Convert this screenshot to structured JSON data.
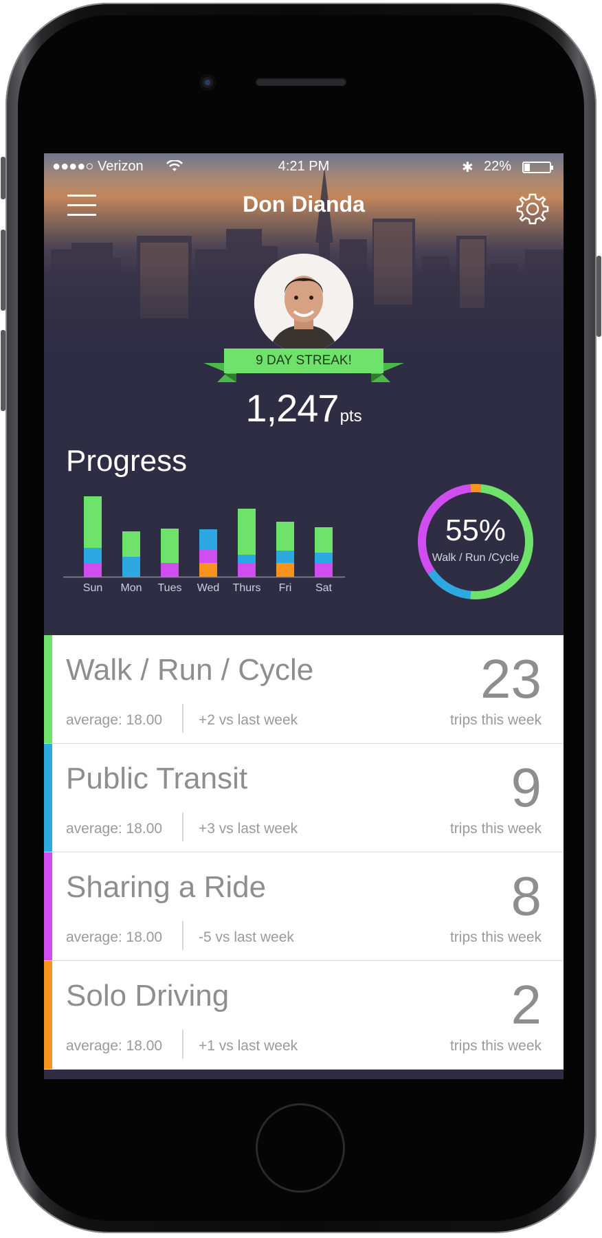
{
  "status_bar": {
    "carrier": "●●●●○ Verizon",
    "time": "4:21 PM",
    "bluetooth": "✱",
    "battery": "22%",
    "battery_level": 0.22
  },
  "header": {
    "user_name": "Don Dianda",
    "menu_icon": "hamburger-menu-icon",
    "settings_icon": "gear-icon",
    "streak_label": "9 DAY STREAK!",
    "points_value": "1,247",
    "points_unit": "pts"
  },
  "progress": {
    "title": "Progress",
    "donut_value": "55%",
    "donut_label": "Walk / Run /Cycle"
  },
  "colors": {
    "walk": "#6ee26a",
    "transit": "#2ea8e0",
    "ride": "#d04ef0",
    "solo": "#f7941d",
    "background": "#2f2d44"
  },
  "chart_data": [
    {
      "type": "bar",
      "stacked": true,
      "categories": [
        "Sun",
        "Mon",
        "Tues",
        "Wed",
        "Thurs",
        "Fri",
        "Sat"
      ],
      "series": [
        {
          "color": "#f7941d",
          "values": [
            0,
            0,
            0,
            20,
            0,
            20,
            0
          ]
        },
        {
          "color": "#d04ef0",
          "values": [
            20,
            0,
            20,
            20,
            20,
            0,
            20
          ]
        },
        {
          "color": "#2ea8e0",
          "values": [
            22,
            29,
            0,
            29,
            12,
            18,
            15
          ]
        },
        {
          "color": "#6ee26a",
          "values": [
            75,
            37,
            50,
            0,
            67,
            42,
            37
          ]
        }
      ],
      "grid": false
    },
    {
      "type": "pie",
      "donut": true,
      "series": [
        {
          "color": "#6ee26a",
          "value": 50
        },
        {
          "color": "#2ea8e0",
          "value": 14
        },
        {
          "color": "#d04ef0",
          "value": 33
        },
        {
          "color": "#f7941d",
          "value": 3
        }
      ]
    }
  ],
  "list": [
    {
      "title": "Walk / Run / Cycle",
      "average": "average: 18.00",
      "delta": "+2 vs last week",
      "count": "23",
      "count_label": "trips this week",
      "color": "#6ee26a"
    },
    {
      "title": "Public Transit",
      "average": "average: 18.00",
      "delta": "+3 vs last week",
      "count": "9",
      "count_label": "trips this week",
      "color": "#2ea8e0"
    },
    {
      "title": "Sharing a Ride",
      "average": "average: 18.00",
      "delta": "-5 vs last week",
      "count": "8",
      "count_label": "trips this week",
      "color": "#d04ef0"
    },
    {
      "title": "Solo Driving",
      "average": "average: 18.00",
      "delta": "+1 vs last week",
      "count": "2",
      "count_label": "trips this week",
      "color": "#f7941d"
    }
  ]
}
